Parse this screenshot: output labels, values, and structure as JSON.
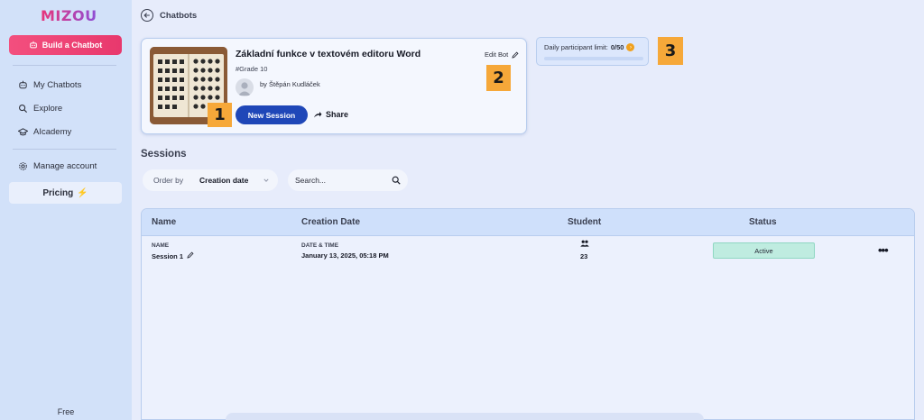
{
  "brand": {
    "logo_text": "MIZOU"
  },
  "sidebar": {
    "build_button": "Build a Chatbot",
    "items": [
      {
        "label": "My Chatbots",
        "icon": "chatbot-icon"
      },
      {
        "label": "Explore",
        "icon": "search-icon"
      },
      {
        "label": "AIcademy",
        "icon": "graduation-cap-icon"
      }
    ],
    "manage_account": "Manage account",
    "pricing": "Pricing",
    "plan": "Free"
  },
  "header": {
    "back_label": "Chatbots"
  },
  "bot": {
    "title": "Základní funkce v textovém editoru Word",
    "tag": "#Grade 10",
    "author": "by Štěpán Kudláček",
    "new_session": "New Session",
    "share": "Share",
    "edit": "Edit Bot"
  },
  "limit": {
    "label": "Daily participant limit:",
    "value": "0/50",
    "fraction": 0
  },
  "annotations": {
    "one": "1",
    "two": "2",
    "three": "3"
  },
  "sessions": {
    "title": "Sessions",
    "order_label": "Order by",
    "order_value": "Creation date",
    "search_placeholder": "Search...",
    "columns": {
      "name": "Name",
      "date": "Creation Date",
      "student": "Student",
      "status": "Status"
    },
    "rows": [
      {
        "name_label": "NAME",
        "name": "Session 1",
        "date_label": "DATE & TIME",
        "date": "January 13, 2025, 05:18 PM",
        "students": "23",
        "status": "Active",
        "more": "•••"
      }
    ]
  },
  "colors": {
    "primary": "#1f47b8",
    "accent": "#e8386d",
    "sidebar": "#d2e1f9",
    "badge": "#f6a839",
    "active": "#bfece0"
  }
}
